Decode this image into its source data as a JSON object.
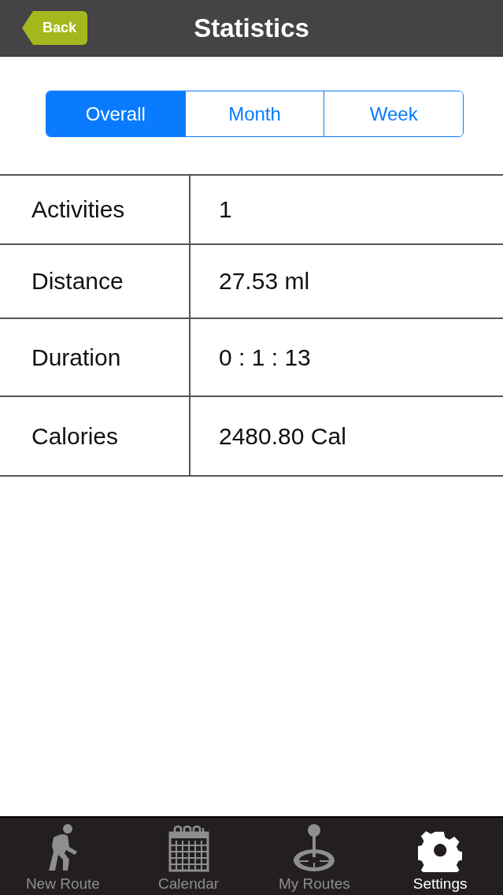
{
  "header": {
    "back": "Back",
    "title": "Statistics"
  },
  "segments": [
    {
      "label": "Overall",
      "selected": true
    },
    {
      "label": "Month",
      "selected": false
    },
    {
      "label": "Week",
      "selected": false
    }
  ],
  "stats": [
    {
      "label": "Activities",
      "value": "1"
    },
    {
      "label": "Distance",
      "value": "27.53 ml"
    },
    {
      "label": "Duration",
      "value": "0 : 1 : 13"
    },
    {
      "label": "Calories",
      "value": "2480.80 Cal"
    }
  ],
  "tab_bar": [
    {
      "label": "New Route",
      "selected": false
    },
    {
      "label": "Calendar",
      "selected": false
    },
    {
      "label": "My Routes",
      "selected": false
    },
    {
      "label": "Settings",
      "selected": true
    }
  ]
}
